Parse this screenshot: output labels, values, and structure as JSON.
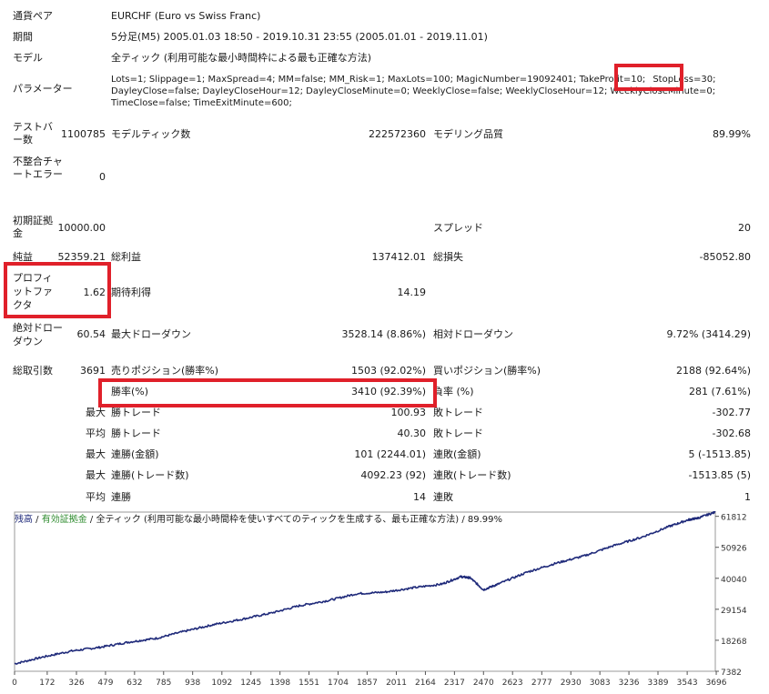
{
  "info": {
    "symbol_label": "通貨ペア",
    "symbol_value": "EURCHF (Euro vs Swiss Franc)",
    "period_label": "期間",
    "period_value": "5分足(M5) 2005.01.03 18:50 - 2019.10.31 23:55 (2005.01.01 - 2019.11.01)",
    "model_label": "モデル",
    "model_value": "全ティック (利用可能な最小時間枠による最も正確な方法)",
    "params_label": "パラメーター",
    "params_line1": "Lots=1; Slippage=1; MaxSpread=4; MM=false; MM_Risk=1; MaxLots=100; MagicNumber=19092401; TakeProfit=10;",
    "params_stoploss": "StopLoss=30;",
    "params_line2": "DayleyClose=false; DayleyCloseHour=12; DayleyCloseMinute=0; WeeklyClose=false; WeeklyCloseHour=12; WeeklyCloseMinute=0;",
    "params_line3": "TimeClose=false; TimeExitMinute=600;"
  },
  "stats": {
    "bars_label": "テストバー数",
    "bars_value": "1100785",
    "ticks_label": "モデルティック数",
    "ticks_value": "222572360",
    "quality_label": "モデリング品質",
    "quality_value": "89.99%",
    "mismatch_label": "不整合チャートエラー",
    "mismatch_value": "0",
    "deposit_label": "初期証拠金",
    "deposit_value": "10000.00",
    "spread_label": "スプレッド",
    "spread_value": "20",
    "netprofit_label": "純益",
    "netprofit_value": "52359.21",
    "grossprofit_label": "総利益",
    "grossprofit_value": "137412.01",
    "grossloss_label": "総損失",
    "grossloss_value": "-85052.80",
    "pf_label": "プロフィットファクタ",
    "pf_value": "1.62",
    "payoff_label": "期待利得",
    "payoff_value": "14.19",
    "absdd_label": "絶対ドローダウン",
    "absdd_value": "60.54",
    "maxdd_label": "最大ドローダウン",
    "maxdd_value": "3528.14 (8.86%)",
    "reldd_label": "相対ドローダウン",
    "reldd_value": "9.72% (3414.29)",
    "trades_label": "総取引数",
    "trades_value": "3691",
    "short_label": "売りポジション(勝率%)",
    "short_value": "1503 (92.02%)",
    "long_label": "買いポジション(勝率%)",
    "long_value": "2188 (92.64%)",
    "winrate_label": "勝率(%)",
    "winrate_value": "3410 (92.39%)",
    "lossrate_label": "負率 (%)",
    "lossrate_value": "281 (7.61%)",
    "q_max": "最大",
    "q_avg": "平均",
    "maxwin_label": "勝トレード",
    "maxwin_value": "100.93",
    "maxloss_label": "敗トレード",
    "maxloss_value": "-302.77",
    "avgwin_label": "勝トレード",
    "avgwin_value": "40.30",
    "avgloss_label": "敗トレード",
    "avgloss_value": "-302.68",
    "conswin_amt_label": "連勝(金額)",
    "conswin_amt_value": "101 (2244.01)",
    "consloss_amt_label": "連敗(金額)",
    "consloss_amt_value": "5 (-1513.85)",
    "conswin_cnt_label": "連勝(トレード数)",
    "conswin_cnt_value": "4092.23 (92)",
    "consloss_cnt_label": "連敗(トレード数)",
    "consloss_cnt_value": "-1513.85 (5)",
    "avgconswin_label": "連勝",
    "avgconswin_value": "14",
    "avgconsloss_label": "連敗",
    "avgconsloss_value": "1"
  },
  "chart_legend": {
    "balance": "残高",
    "sep1": " / ",
    "equity": "有効証拠金",
    "sep2": " / ",
    "model": "全ティック (利用可能な最小時間枠を使いすべてのティックを生成する、最も正確な方法)",
    "sep3": " / ",
    "quality": "89.99%"
  },
  "colors": {
    "highlight": "#e0202a",
    "balance_line": "#1f2a7a",
    "equity_legend": "#2e8b2e",
    "balance_legend": "#1f2a7a"
  },
  "chart_data": {
    "type": "line",
    "title": "",
    "x_ticks": [
      0,
      172,
      326,
      479,
      632,
      785,
      938,
      1092,
      1245,
      1398,
      1551,
      1704,
      1857,
      2011,
      2164,
      2317,
      2470,
      2623,
      2777,
      2930,
      3083,
      3236,
      3389,
      3543,
      3696
    ],
    "y_ticks": [
      7382,
      18268,
      29154,
      40040,
      50926,
      61812
    ],
    "xlim": [
      0,
      3691
    ],
    "ylim": [
      7382,
      63300
    ],
    "series": [
      {
        "name": "残高",
        "x": [
          0,
          150,
          300,
          450,
          600,
          750,
          900,
          1050,
          1200,
          1350,
          1500,
          1650,
          1800,
          1950,
          2100,
          2250,
          2350,
          2400,
          2470,
          2550,
          2700,
          2850,
          3000,
          3150,
          3300,
          3450,
          3550,
          3600,
          3691
        ],
        "y": [
          10000,
          12400,
          14500,
          15800,
          17600,
          19000,
          21500,
          23800,
          25700,
          27800,
          30400,
          32200,
          34600,
          35200,
          36700,
          38000,
          40600,
          40200,
          36000,
          38100,
          42200,
          45300,
          47900,
          51400,
          54400,
          58300,
          60600,
          61200,
          63300
        ]
      }
    ]
  }
}
